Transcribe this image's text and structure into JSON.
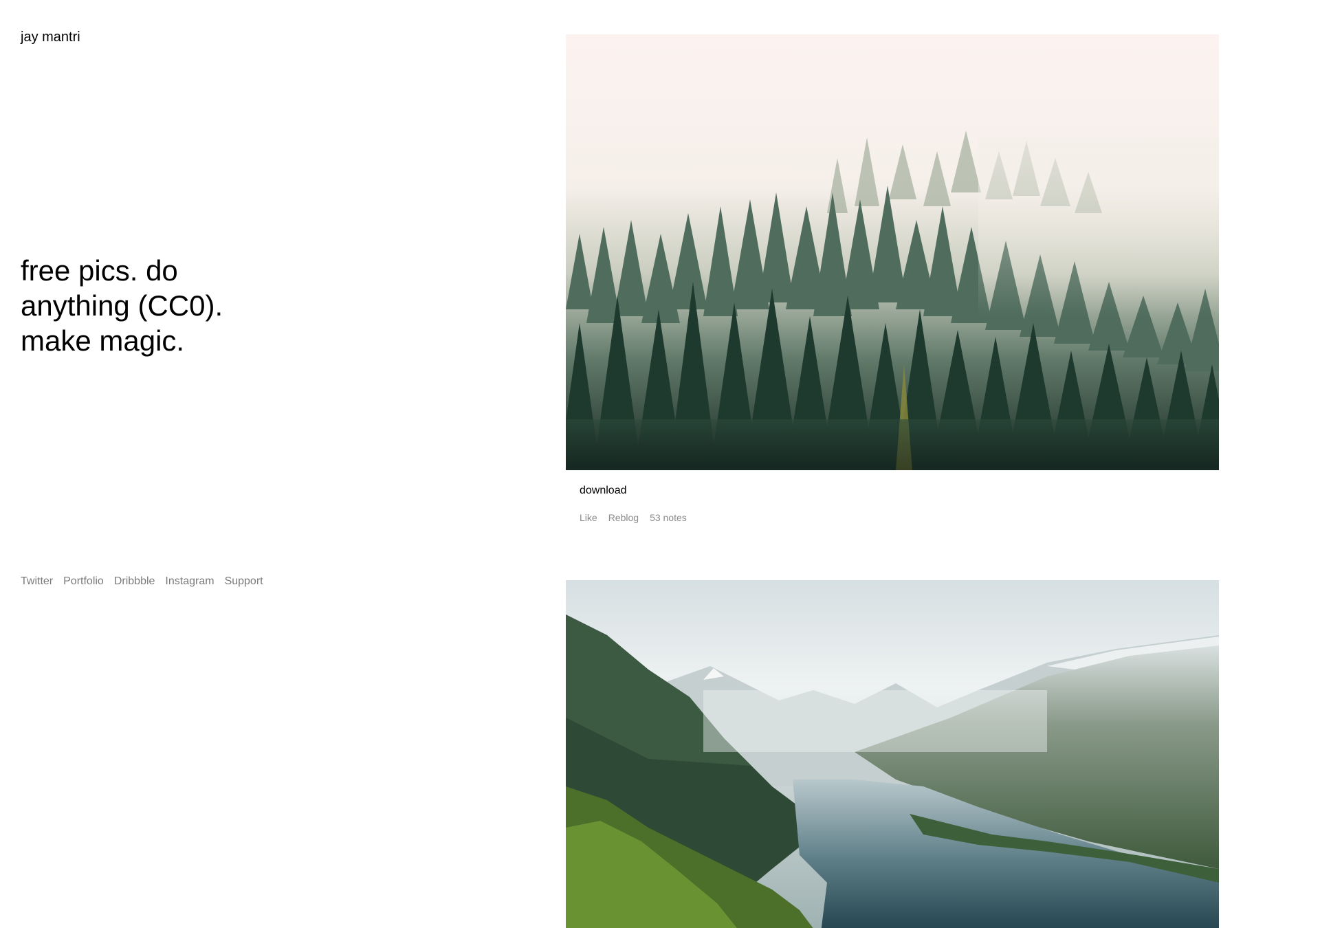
{
  "site": {
    "title": "jay mantri",
    "tagline": "free pics. do anything (CC0). make magic."
  },
  "nav": {
    "links": [
      {
        "label": "Twitter"
      },
      {
        "label": "Portfolio"
      },
      {
        "label": "Dribbble"
      },
      {
        "label": "Instagram"
      },
      {
        "label": "Support"
      }
    ]
  },
  "posts": [
    {
      "photo_subject": "misty-pine-forest",
      "caption_link": "download",
      "actions": {
        "like": "Like",
        "reblog": "Reblog",
        "notes": "53 notes"
      }
    },
    {
      "photo_subject": "mountain-fjord"
    }
  ],
  "colors": {
    "text": "#000000",
    "muted": "#7a7a7a",
    "background": "#ffffff"
  }
}
